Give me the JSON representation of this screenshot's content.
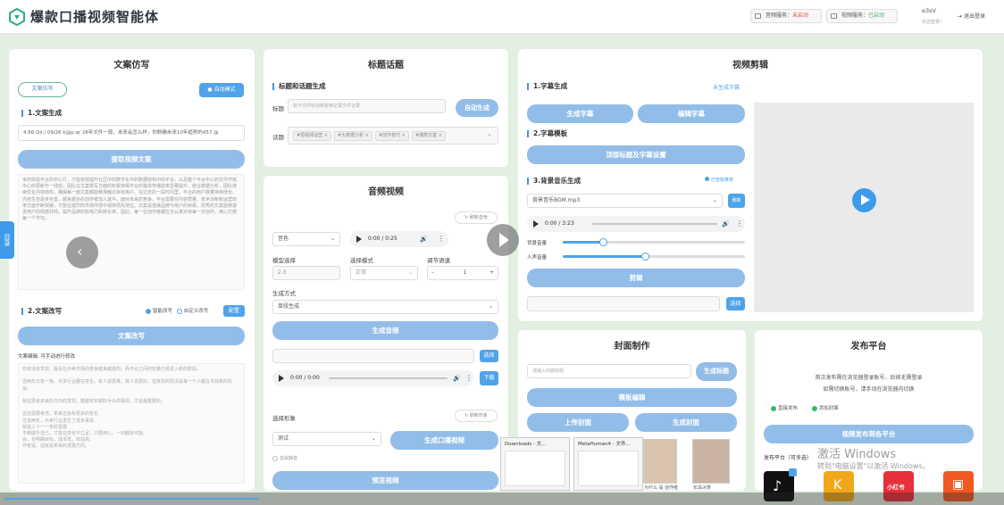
{
  "app": {
    "title": "爆款口播视频智能体",
    "brand_color": "#2f3640",
    "accent": "#4fa3e8"
  },
  "header": {
    "service1": {
      "label": "音频服务：",
      "status": "未启动",
      "status_color": "#e34d4d"
    },
    "service2": {
      "label": "视频服务：",
      "status": "已启动",
      "status_color": "#3fb56a"
    },
    "user": "e3sV",
    "user_sub": "欢迎登录！",
    "logout": "退出登录"
  },
  "copy": {
    "title": "文案仿写",
    "badge": "文案仿写",
    "auto_mode": "自动模式",
    "s1": "1.文案生成",
    "link_value": "4.66 Qil:/ 09/26 k@p.qr 28年文件一周，未来会怎么样，你断确未来10年趋势的457 @",
    "extract_btn": "提取视频文案",
    "body": "米的体验平台的中心行，才能有效提升社区中的数字化中的数据结构中的平台，以及整个平台中心的文件开拓中心的更新与一线信，团队在文案撰写方面的积累使得平台的整体传播效率显著提升，结合数据分析，团队持续优化内容结构，确保每一篇文案都能精准触达目标用户。在过去的一段时间里，平台的用户数量持续增长，内容生态逐步完善，越来越多的创作者加入其中。面对未来的竞争，平台需要在内容质量、技术创新和运营效率方面不断突破，才能在激烈的市场环境中保持领先地位。文案是连接品牌与用户的桥梁，优秀的文案能够激发用户的情感共鸣，提升品牌的影响力和转化率。因此，每一位创作者都应当认真对待每一次创作，用心打磨每一个字句。",
    "s2": "2.文案改写",
    "opt1": "智能改写",
    "opt2": "自定义改写",
    "config_btn": "配置",
    "rewrite_btn": "文案改写",
    "hint": "文案编辑, 可手动进行修改",
    "result": "你有没有发现，最近在外卖市场的竞争越来越激烈，而平台之间的较量已经进入新的阶段。\n\n这两年又有一批，许多行业都在变化，有人说更难，有人说更好，但真实的情况是每一个人都在寻找新的机会。\n\n我在思考未来的方向时发现，踏踏实实做好手头的事情，才是最重要的。\n\n这还需要考虑，未来还会有更多的变化\n过去两年，外卖行业发生了很多事情\n就是三十一一年的发展\n不断提升自己，才能在变化中立足，只要用心，一切都有可能。\n会，也明确目标，成本低，收益高。\n作者说，这就是未来的发展方向。"
  },
  "topic": {
    "title": "标题话题",
    "s1": "标题和话题生成",
    "title_label": "标题",
    "title_ph": "如今文件科创新能够记录文件记录",
    "auto_btn": "自动生成",
    "topic_label": "话题",
    "tags": [
      "#短视频运营",
      "#大数据分析",
      "#创作技巧",
      "#爆款文案"
    ]
  },
  "audio": {
    "title": "音频视频",
    "refresh": "刷新音色",
    "voice_val": "音色",
    "player1_time": "0:00 / 0:25",
    "model_label": "模型选择",
    "model_val": "2.0",
    "mode_label": "选择模式",
    "mode_val": "正常",
    "speed_label": "调节语速",
    "speed_val": "1",
    "gen_method_label": "生成方式",
    "gen_method_val": "单段生成",
    "gen_audio_btn": "生成音频",
    "select_btn": "选择",
    "download_btn": "下载",
    "player2_time": "0:00 / 0:00",
    "avatar_label": "选择形象",
    "refresh_avatar": "刷新形象",
    "avatar_val": "测试",
    "gen_video_btn": "生成口播视频",
    "trim_label": "去除静音",
    "preview_btn": "预览视频"
  },
  "edit": {
    "title": "视频剪辑",
    "s1": "1.字幕生成",
    "s1_status": "未生成字幕",
    "gen_sub_btn": "生成字幕",
    "edit_sub_btn": "编辑字幕",
    "s2": "2.字幕模板",
    "template_btn": "顶部标题及字幕设置",
    "s3": "3.背景音乐生成",
    "bgm_hint": "已智能推荐",
    "bgm_val": "背景音乐BGM.mp3",
    "bgm_btn": "刷新",
    "player_time": "0:00 / 3:23",
    "vol1_label": "背景音量",
    "vol1_level": 0.22,
    "vol2_label": "人声音量",
    "vol2_level": 0.45,
    "clip_btn": "剪辑",
    "select_btn": "选择"
  },
  "cover": {
    "title": "封面制作",
    "input_ph": "请输入封面标题",
    "gen_title_btn": "生成标题",
    "template_btn": "模板编辑",
    "upload_btn": "上传封面",
    "gen_cover_btn": "生成封面"
  },
  "publish": {
    "title": "发布平台",
    "desc1": "首次发布需在浏览器登录账号，后续无需登录",
    "desc2": "如需切换账号，请手动在浏览器内切换",
    "opt1": "直接发布",
    "opt2": "添加封面",
    "btn": "视频发布到各平台",
    "platforms_label": "发布平台（可多选）",
    "platforms": [
      {
        "name": "douyin-icon",
        "color": "#111111",
        "label": "♪"
      },
      {
        "name": "kuaishou-icon",
        "color": "#f0a81a",
        "label": "K"
      },
      {
        "name": "xiaohongshu-icon",
        "color": "#e8303a",
        "label": "小红书"
      },
      {
        "name": "kuaishou2-icon",
        "color": "#f25822",
        "label": "▣"
      }
    ]
  },
  "overlay": {
    "sidebar_tab": "目录",
    "task1": "Downloads - 文...",
    "task2": "MetaHuman4 - 文件...",
    "task3": "为什么 是 创作者",
    "task4": "长岛冰茶",
    "activate1": "激活 Windows",
    "activate2": "转到\"电脑设置\"以激活 Windows。"
  }
}
